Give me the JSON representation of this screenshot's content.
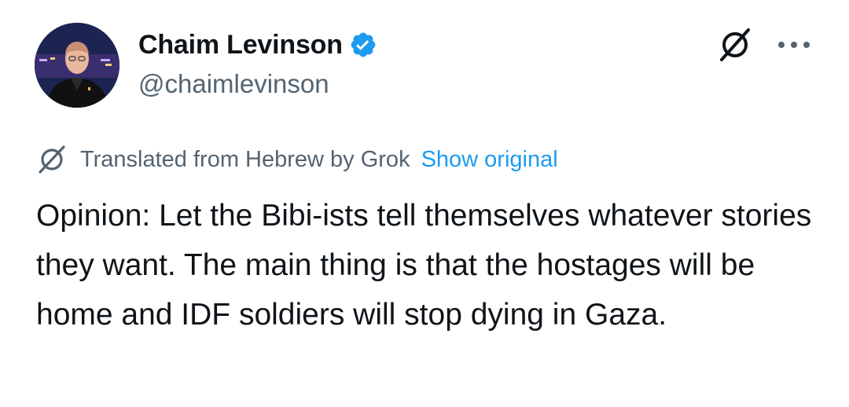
{
  "author": {
    "display_name": "Chaim Levinson",
    "handle": "@chaimlevinson",
    "verified": true,
    "avatar_icon": "profile-photo-avatar",
    "verified_icon": "verified-badge-icon"
  },
  "header_icons": {
    "grok": "grok-icon",
    "more": "more-options-icon"
  },
  "translation": {
    "icon": "grok-icon",
    "label": "Translated from Hebrew by Grok",
    "show_original_label": "Show original"
  },
  "tweet": {
    "text": "Opinion: Let the Bibi-ists tell themselves whatever stories they want. The main thing is that the hostages will be home and IDF soldiers will stop dying in Gaza."
  },
  "colors": {
    "text_primary": "#0f1419",
    "text_secondary": "#536471",
    "link": "#1d9bf0",
    "verified": "#1d9bf0",
    "background": "#ffffff"
  }
}
